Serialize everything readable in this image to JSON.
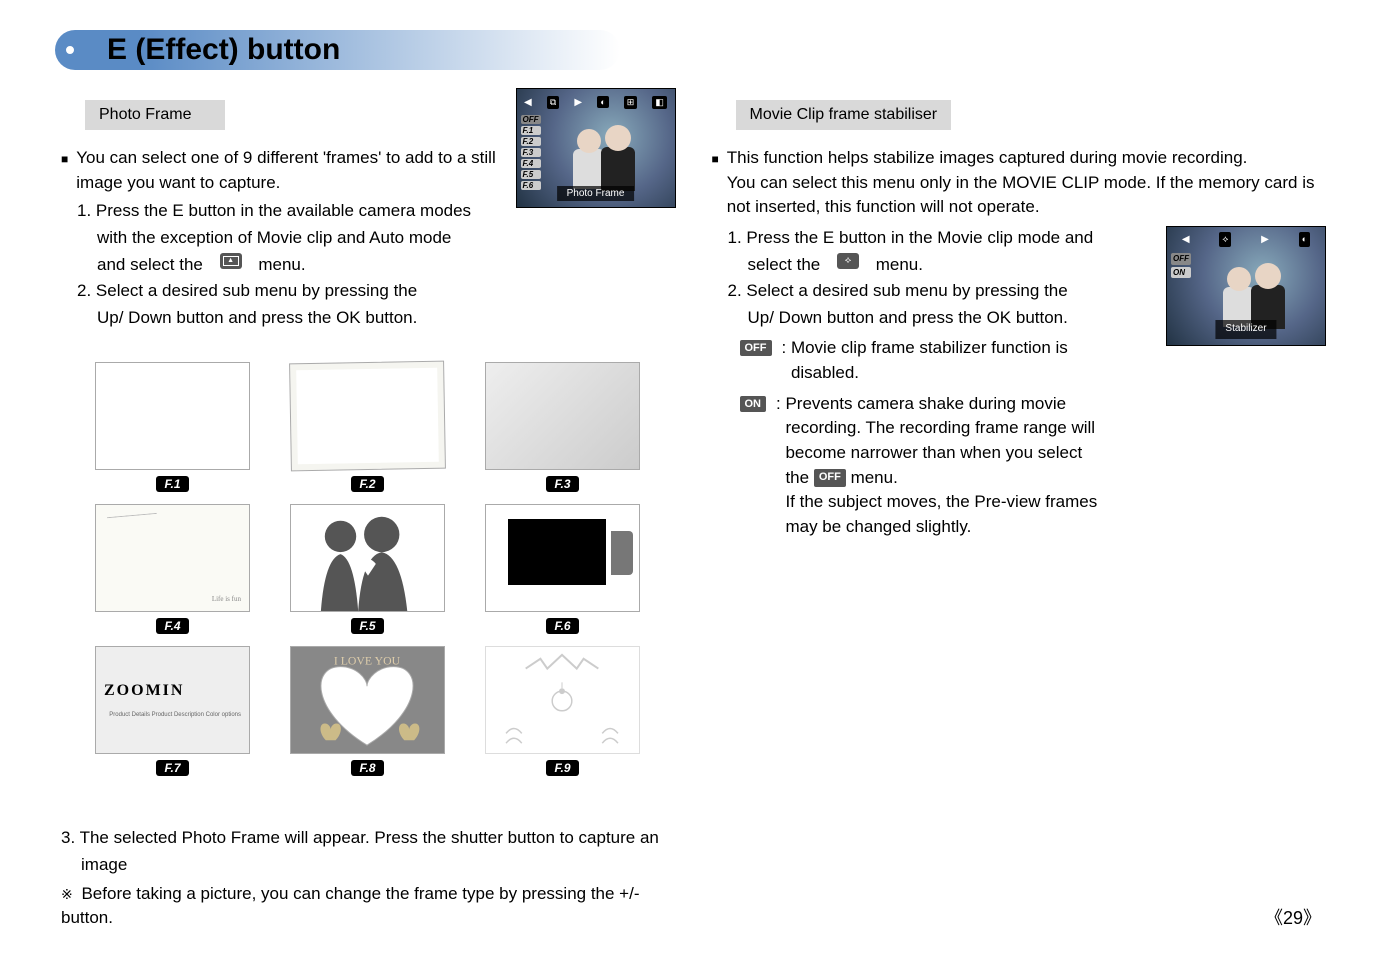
{
  "title": "E (Effect) button",
  "left": {
    "section_label": "Photo Frame",
    "intro": "You can select one of 9 different 'frames' to add to a still image you want to capture.",
    "step1_a": "1. Press the E button in the available camera modes",
    "step1_b": "with the exception of Movie clip and Auto mode",
    "step1_c": "and select the",
    "step1_d": "menu.",
    "step2_a": "2. Select a desired sub menu by pressing the",
    "step2_b": "Up/ Down button and press the OK button.",
    "lcd_caption": "Photo Frame",
    "lcd_side": [
      "OFF",
      "F.1",
      "F.2",
      "F.3",
      "F.4",
      "F.5",
      "F.6"
    ],
    "frame_labels": [
      "F.1",
      "F.2",
      "F.3",
      "F.4",
      "F.5",
      "F.6",
      "F.7",
      "F.8",
      "F.9"
    ],
    "f4_text": "Life is fun",
    "f7_logo": "ZOOMIN",
    "f7_lines": "Product Details\nProduct Description\nColor options",
    "f8_text": "I LOVE YOU",
    "step3_a": "3. The selected Photo Frame will appear. Press the shutter button to capture an",
    "step3_b": "image",
    "note": "Before taking a picture, you can change the frame type by pressing the +/- button."
  },
  "right": {
    "section_label": "Movie Clip frame stabiliser",
    "intro_a": "This function helps stabilize images captured during movie recording.",
    "intro_b": "You can select this menu only in the MOVIE CLIP mode. If the memory card is",
    "intro_c": "not inserted, this function will not operate.",
    "step1_a": "1. Press the E button in the Movie clip mode and",
    "step1_b": "select the",
    "step1_c": "menu.",
    "step2_a": "2. Select a desired sub menu by pressing the",
    "step2_b": "Up/ Down button and press the OK button.",
    "off_label": "OFF",
    "off_text_a": ": Movie clip frame stabilizer function is",
    "off_text_b": "disabled.",
    "on_label": "ON",
    "on_text_a": ": Prevents camera shake during movie",
    "on_text_b": "recording. The recording frame range will",
    "on_text_c": "become narrower than when you select",
    "on_text_d": "the",
    "on_text_e": "menu.",
    "on_text_f": "If the subject moves, the Pre-view frames",
    "on_text_g": "may be changed slightly.",
    "lcd_caption": "Stabilizer",
    "lcd_side": [
      "OFF",
      "ON"
    ]
  },
  "page_number": "29"
}
